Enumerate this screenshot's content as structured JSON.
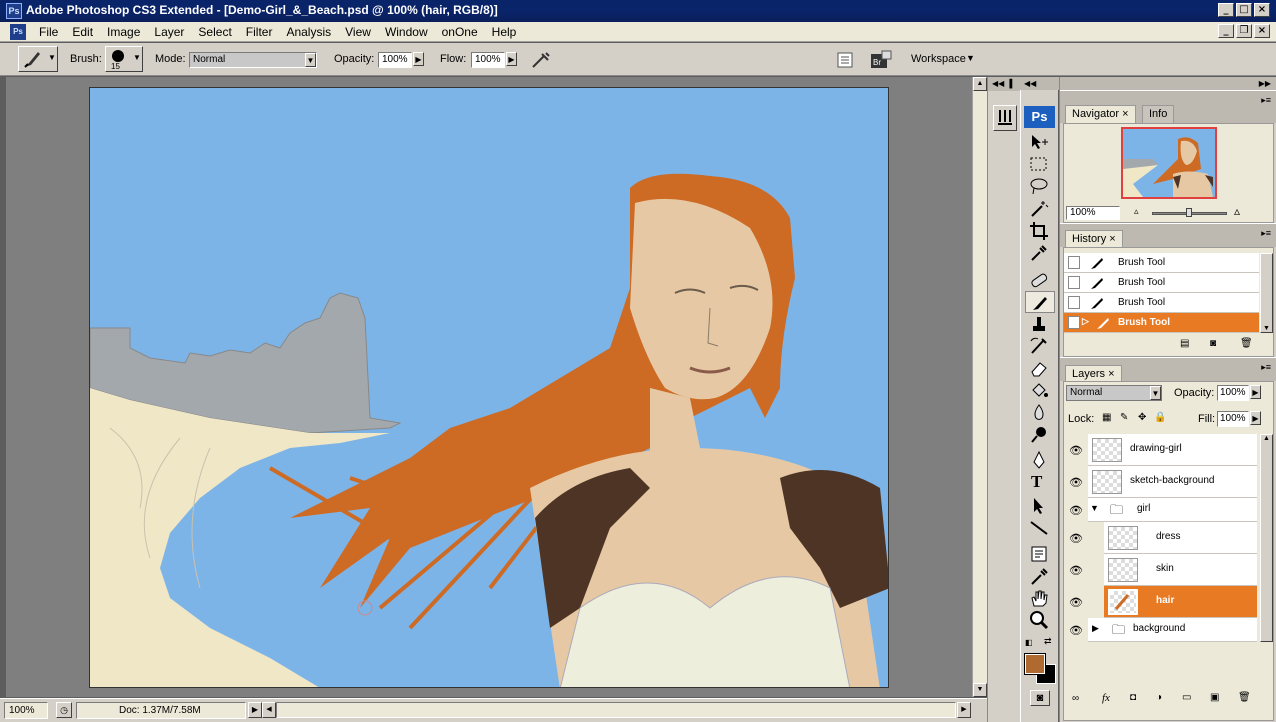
{
  "titlebar": {
    "app_badge": "Ps",
    "title": "Adobe Photoshop CS3 Extended - [Demo-Girl_&_Beach.psd @ 100% (hair, RGB/8)]"
  },
  "menubar": {
    "items": [
      "File",
      "Edit",
      "Image",
      "Layer",
      "Select",
      "Filter",
      "Analysis",
      "View",
      "Window",
      "onOne",
      "Help"
    ]
  },
  "options": {
    "brush_label": "Brush:",
    "brush_size": "15",
    "mode_label": "Mode:",
    "mode_value": "Normal",
    "opacity_label": "Opacity:",
    "opacity_value": "100%",
    "flow_label": "Flow:",
    "flow_value": "100%",
    "workspace_label": "Workspace"
  },
  "navigator": {
    "tab_navigator": "Navigator",
    "tab_info": "Info",
    "zoom": "100%"
  },
  "history": {
    "tab": "History",
    "items": [
      "Brush Tool",
      "Brush Tool",
      "Brush Tool",
      "Brush Tool"
    ],
    "selected_index": 3
  },
  "layers": {
    "tab": "Layers",
    "blend_mode": "Normal",
    "opacity_label": "Opacity:",
    "opacity_value": "100%",
    "lock_label": "Lock:",
    "fill_label": "Fill:",
    "fill_value": "100%",
    "items": [
      {
        "name": "drawing-girl",
        "type": "layer",
        "indent": 0
      },
      {
        "name": "sketch-background",
        "type": "layer",
        "indent": 0
      },
      {
        "name": "girl",
        "type": "group",
        "indent": 0
      },
      {
        "name": "dress",
        "type": "layer",
        "indent": 1
      },
      {
        "name": "skin",
        "type": "layer",
        "indent": 1
      },
      {
        "name": "hair",
        "type": "layer",
        "indent": 1,
        "selected": true
      },
      {
        "name": "background",
        "type": "group",
        "indent": 0
      }
    ]
  },
  "toolbox": {
    "badge": "Ps"
  },
  "status": {
    "zoom": "100%",
    "doc": "Doc: 1.37M/7.58M"
  },
  "colors": {
    "foreground": "#b06a30",
    "background": "#000000",
    "hair": "#d1691f",
    "sky": "#7db4e8",
    "selection": "#e87a24"
  }
}
